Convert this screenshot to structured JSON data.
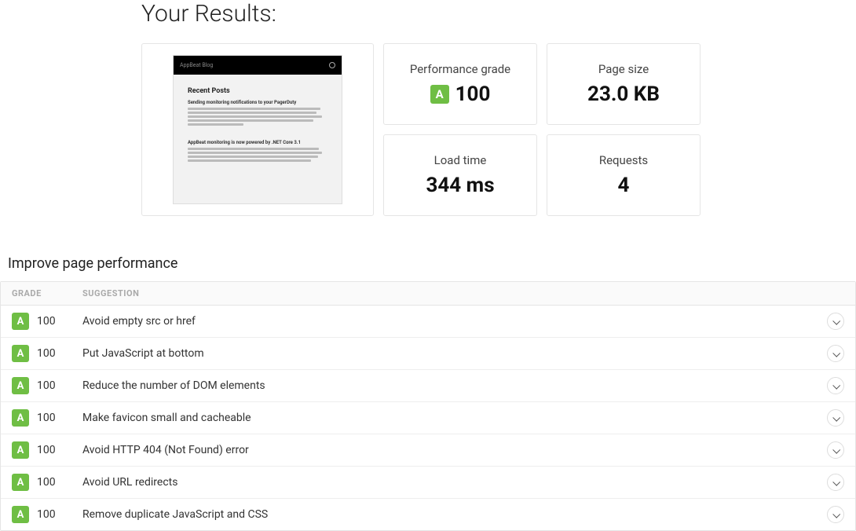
{
  "header": {
    "title": "Your Results:"
  },
  "preview": {
    "site_title": "AppBeat Blog",
    "h1": "Recent Posts",
    "post1_title": "Sending monitoring notifications to your PagerDuty",
    "post2_title": "AppBeat monitoring is now powered by .NET Core 3.1"
  },
  "metrics": [
    {
      "label": "Performance grade",
      "grade": "A",
      "value": "100"
    },
    {
      "label": "Page size",
      "value": "23.0 KB"
    },
    {
      "label": "Load time",
      "value": "344 ms"
    },
    {
      "label": "Requests",
      "value": "4"
    }
  ],
  "improve": {
    "title": "Improve page performance",
    "columns": {
      "grade": "GRADE",
      "suggestion": "SUGGESTION"
    },
    "rows": [
      {
        "grade": "A",
        "score": "100",
        "suggestion": "Avoid empty src or href"
      },
      {
        "grade": "A",
        "score": "100",
        "suggestion": "Put JavaScript at bottom"
      },
      {
        "grade": "A",
        "score": "100",
        "suggestion": "Reduce the number of DOM elements"
      },
      {
        "grade": "A",
        "score": "100",
        "suggestion": "Make favicon small and cacheable"
      },
      {
        "grade": "A",
        "score": "100",
        "suggestion": "Avoid HTTP 404 (Not Found) error"
      },
      {
        "grade": "A",
        "score": "100",
        "suggestion": "Avoid URL redirects"
      },
      {
        "grade": "A",
        "score": "100",
        "suggestion": "Remove duplicate JavaScript and CSS"
      }
    ]
  }
}
